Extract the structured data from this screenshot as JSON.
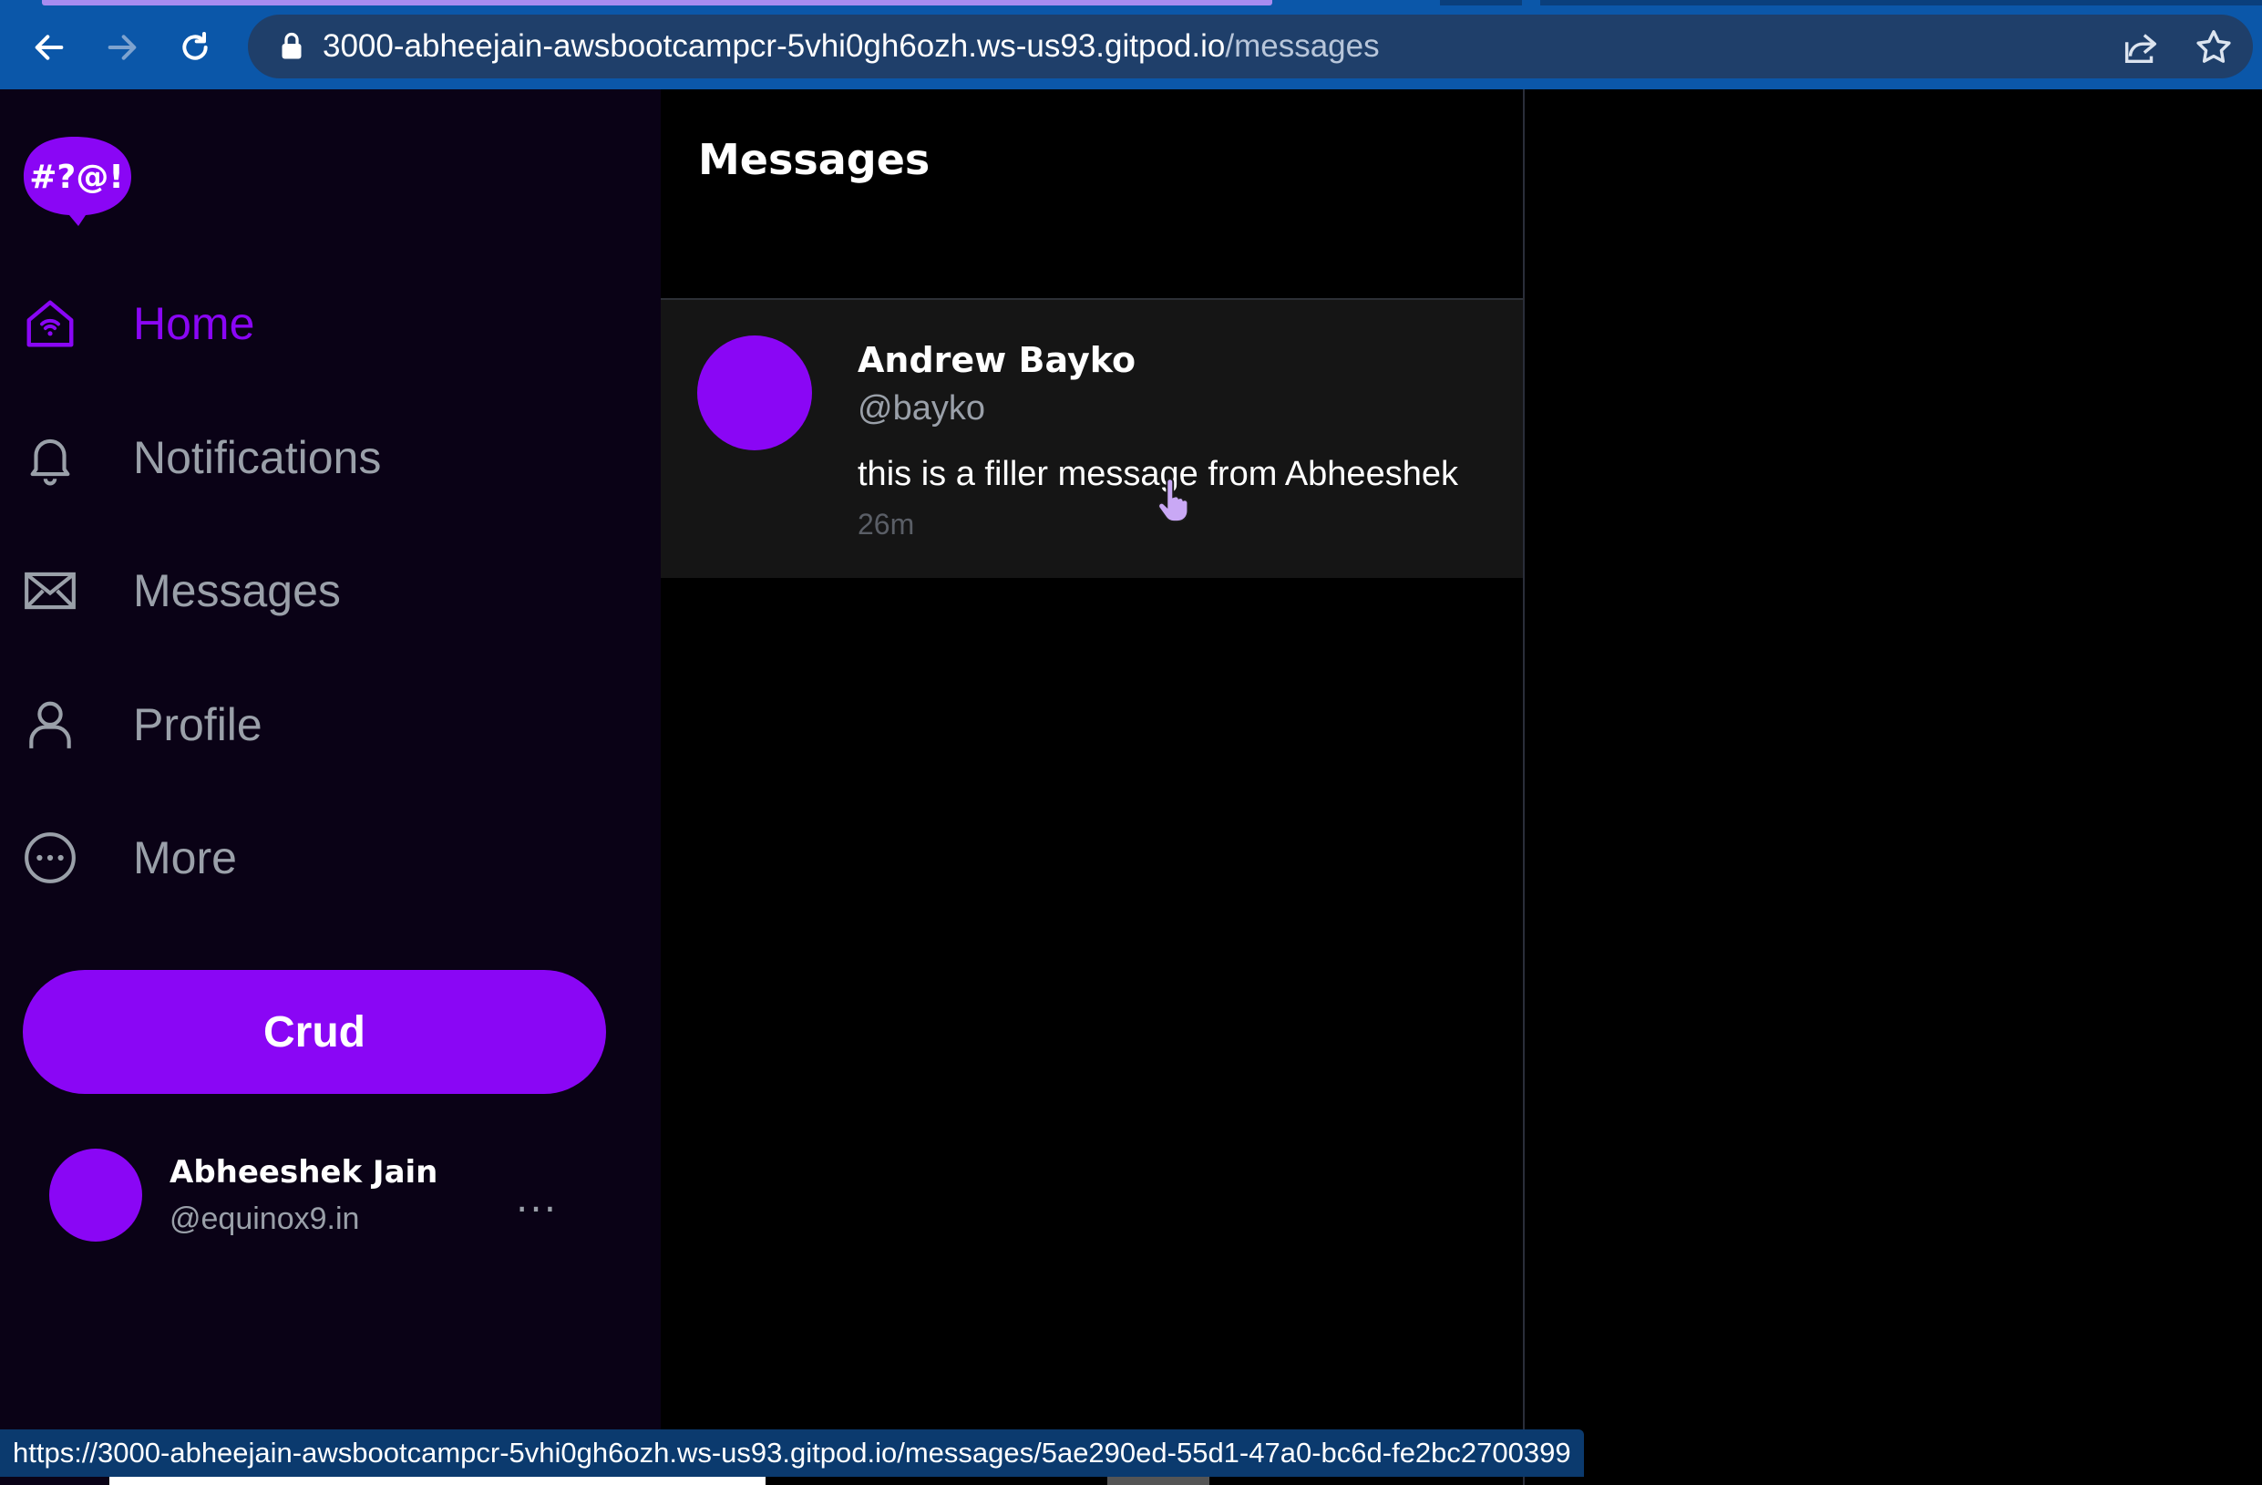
{
  "browser": {
    "url_host": "3000-abheejain-awsbootcampcr-5vhi0gh6ozh.ws-us93.gitpod.io",
    "url_path": "/messages",
    "status_url": "https://3000-abheejain-awsbootcampcr-5vhi0gh6ozh.ws-us93.gitpod.io/messages/5ae290ed-55d1-47a0-bc6d-fe2bc2700399"
  },
  "logo": {
    "text": "#?@!",
    "icon": "speech-bubble-logo"
  },
  "sidebar": {
    "items": [
      {
        "label": "Home",
        "icon": "home-icon",
        "active": true
      },
      {
        "label": "Notifications",
        "icon": "bell-icon",
        "active": false
      },
      {
        "label": "Messages",
        "icon": "envelope-icon",
        "active": false
      },
      {
        "label": "Profile",
        "icon": "person-icon",
        "active": false
      },
      {
        "label": "More",
        "icon": "more-circle-icon",
        "active": false
      }
    ],
    "crud_label": "Crud",
    "user": {
      "name": "Abheeshek Jain",
      "handle": "@equinox9.in",
      "more": "..."
    }
  },
  "main": {
    "title": "Messages",
    "groups": [
      {
        "name": "Andrew Bayko",
        "handle": "@bayko",
        "message": "this is a filler message from Abheeshek",
        "time": "26m"
      }
    ]
  },
  "colors": {
    "accent": "#8a06f5",
    "sidebar_bg": "#0a0216",
    "muted_text": "#9aa0a9",
    "row_bg": "#151515",
    "chrome_bg": "#0b57a9"
  }
}
